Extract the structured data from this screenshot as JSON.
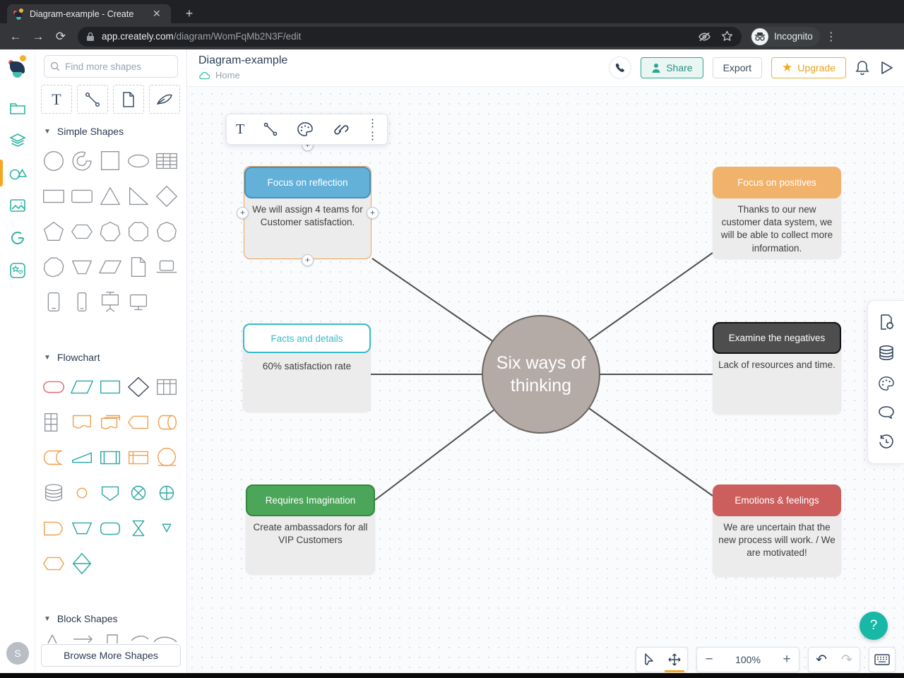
{
  "browser": {
    "tab_title": "Diagram-example - Create",
    "close_glyph": "✕",
    "new_tab_glyph": "+",
    "url_domain": "app.creately.com",
    "url_path": "/diagram/WomFqMb2N3F/edit",
    "incognito_label": "Incognito"
  },
  "app_header": {
    "title": "Diagram-example",
    "breadcrumb": "Home",
    "share_label": "Share",
    "export_label": "Export",
    "upgrade_label": "Upgrade"
  },
  "left_rail": {
    "icons": [
      "creately-logo",
      "folder",
      "layers",
      "shapes",
      "image",
      "google-g",
      "stickers"
    ],
    "avatar_initial": "S"
  },
  "sidebar": {
    "search_placeholder": "Find more shapes",
    "tool_icons": [
      "text-tool",
      "connector-tool",
      "page-tool",
      "freehand-tool"
    ],
    "sections": [
      {
        "label": "Simple Shapes"
      },
      {
        "label": "Flowchart"
      },
      {
        "label": "Block Shapes"
      }
    ],
    "browse_more_label": "Browse More Shapes"
  },
  "floating_toolbar": {
    "icons": [
      "text",
      "connector",
      "style-palette",
      "link",
      "more"
    ]
  },
  "diagram": {
    "center_label": "Six ways of thinking",
    "center_bg": "#b4aaa6",
    "edge_color": "#4d4d4d",
    "selection_color": "#f2a35c",
    "nodes": [
      {
        "title": "Focus on reflection",
        "body": "We will assign 4 teams for Customer satisfaction.",
        "header_bg": "#63b1d9",
        "header_border": "#3f94c1",
        "title_color": "#ffffff"
      },
      {
        "title": "Facts and details",
        "body": "60% satisfaction rate",
        "header_bg": "#ffffff",
        "header_border": "#36bcc9",
        "title_color": "#36bcc9"
      },
      {
        "title": "Requires Imagination",
        "body": "Create ambassadors for all VIP Customers",
        "header_bg": "#4ba65a",
        "header_border": "#37853f",
        "title_color": "#ffffff"
      },
      {
        "title": "Focus on positives",
        "body": "Thanks to our new customer data system, we will be able to collect more information.",
        "header_bg": "#f1b26c",
        "header_border": "#f1b26c",
        "title_color": "#ffffff"
      },
      {
        "title": "Examine the negatives",
        "body": "Lack of resources and time.",
        "header_bg": "#4e4e4e",
        "header_border": "#111111",
        "title_color": "#ffffff"
      },
      {
        "title": "Emotions & feelings",
        "body": "We are uncertain that the new process will work. / We are motivated!",
        "header_bg": "#cd5e5e",
        "header_border": "#cd5e5e",
        "title_color": "#ffffff"
      }
    ]
  },
  "right_panel": {
    "icons": [
      "diagram-settings",
      "data",
      "styles",
      "comments",
      "history"
    ]
  },
  "footer": {
    "zoom_value": "100%"
  },
  "help": {
    "label": "?"
  }
}
